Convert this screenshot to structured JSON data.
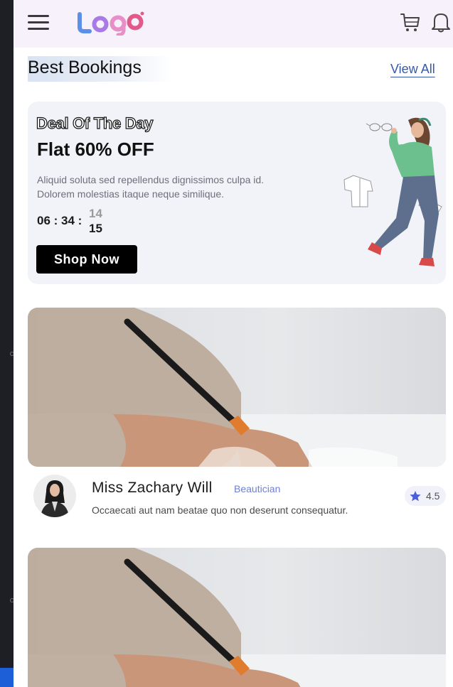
{
  "header": {
    "menu_icon": "hamburger-menu-icon",
    "logo_text": "Logo",
    "logo_colors": [
      "#5b8fe8",
      "#a77ae6",
      "#e88fc7",
      "#e05b8a"
    ],
    "cart_icon": "cart-icon",
    "bell_icon": "bell-icon"
  },
  "section": {
    "title": "Best Bookings",
    "view_all": "View All"
  },
  "deal": {
    "title": "Deal Of The Day",
    "offer": "Flat 60% OFF",
    "description": "Aliquid soluta sed repellendus dignissimos culpa id. Dolorem molestias itaque neque similique.",
    "timer": {
      "hours": "06",
      "minutes": "34",
      "seconds_prev": "14",
      "seconds": "15"
    },
    "button": "Shop Now"
  },
  "bookings": [
    {
      "name": "Miss Zachary Will",
      "role": "Beautician",
      "description": "Occaecati aut nam beatae quo non deserunt consequatur.",
      "rating": "4.5"
    },
    {
      "name": "",
      "role": "",
      "description": "",
      "rating": ""
    }
  ],
  "colors": {
    "header_bg": "#f6f1fa",
    "link": "#3659a8",
    "role": "#6e7fd6",
    "star": "#4d5fd6"
  }
}
